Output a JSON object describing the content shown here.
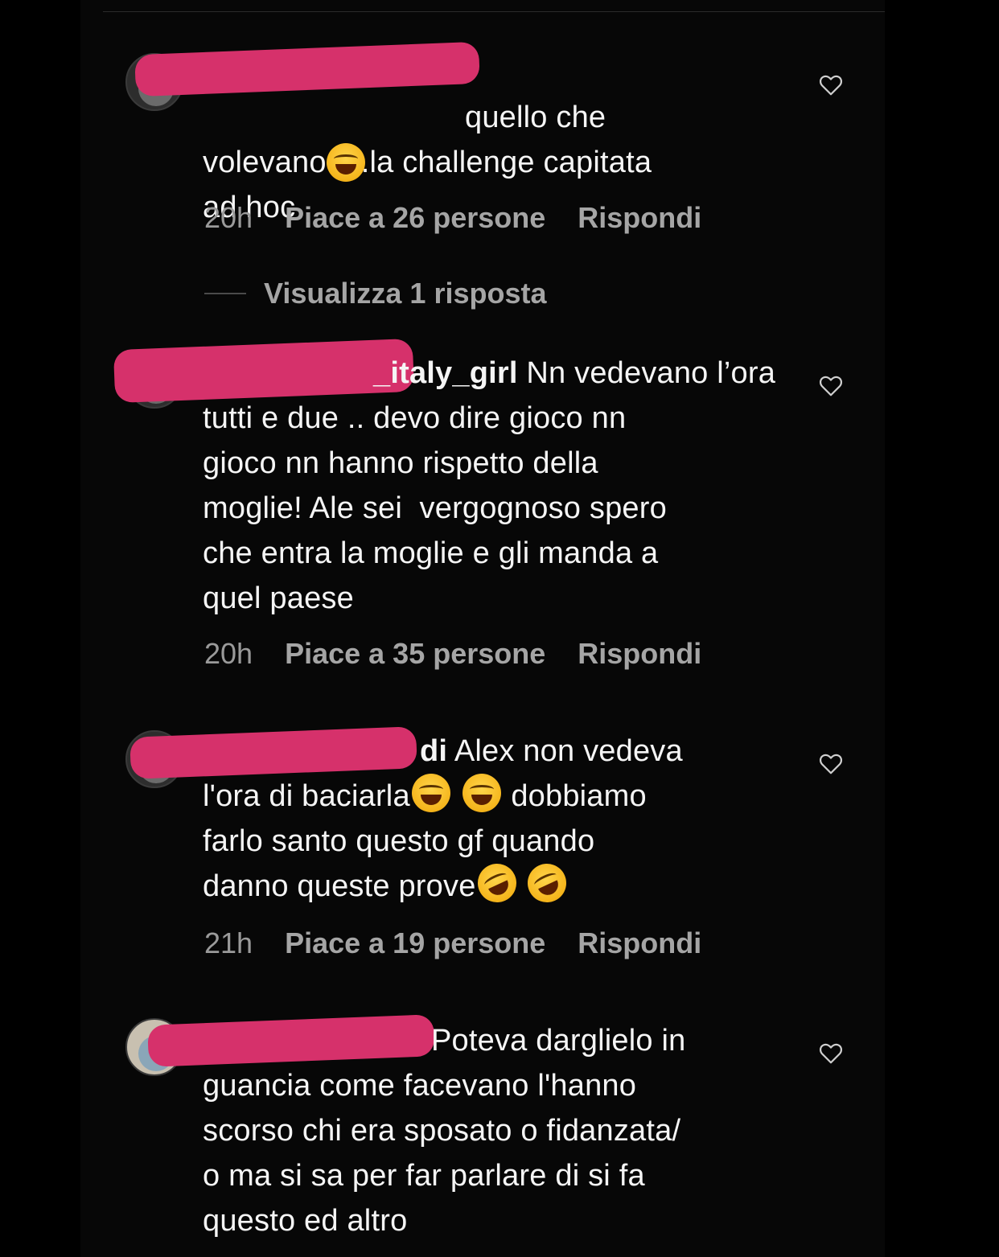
{
  "comments": [
    {
      "username_visible": "",
      "text": "quello che\nvolevano ....la challenge capitata\nad hoc",
      "emojis": [
        "face-with-tears-of-joy"
      ],
      "time": "20h",
      "likes": "Piace a 26 persone",
      "reply": "Rispondi",
      "view_replies": "Visualizza 1 risposta"
    },
    {
      "username_visible": "_italy_girl",
      "text": " Nn vedevano l’ora\ntutti e due .. devo dire gioco nn\ngioco nn hanno rispetto della\nmoglie! Ale sei  vergognoso spero\nche entra la moglie e gli manda a\nquel paese",
      "time": "20h",
      "likes": "Piace a 35 persone",
      "reply": "Rispondi"
    },
    {
      "username_visible": "di",
      "text_line1": " Alex non vedeva",
      "text_line2a": "l'ora di baciarla",
      "text_line2b": " dobbiamo",
      "text_line3": "farlo santo questo gf quando",
      "text_line4": "danno queste prove",
      "emojis": [
        "face-with-tears-of-joy",
        "face-with-tears-of-joy",
        "rolling-on-the-floor-laughing",
        "rolling-on-the-floor-laughing"
      ],
      "time": "21h",
      "likes": "Piace a 19 persone",
      "reply": "Rispondi"
    },
    {
      "username_visible": "",
      "text": "Poteva darglielo in\nguancia come facevano l'hanno\nscorso chi era sposato o fidanzata/\no ma si sa per far parlare di si fa\nquesto ed altro"
    }
  ],
  "colors": {
    "background": "#000000",
    "text": "#f5f5f5",
    "meta": "#a5a5a5",
    "redaction": "#d6316b"
  },
  "icons": [
    "heart-outline-icon",
    "avatar"
  ]
}
